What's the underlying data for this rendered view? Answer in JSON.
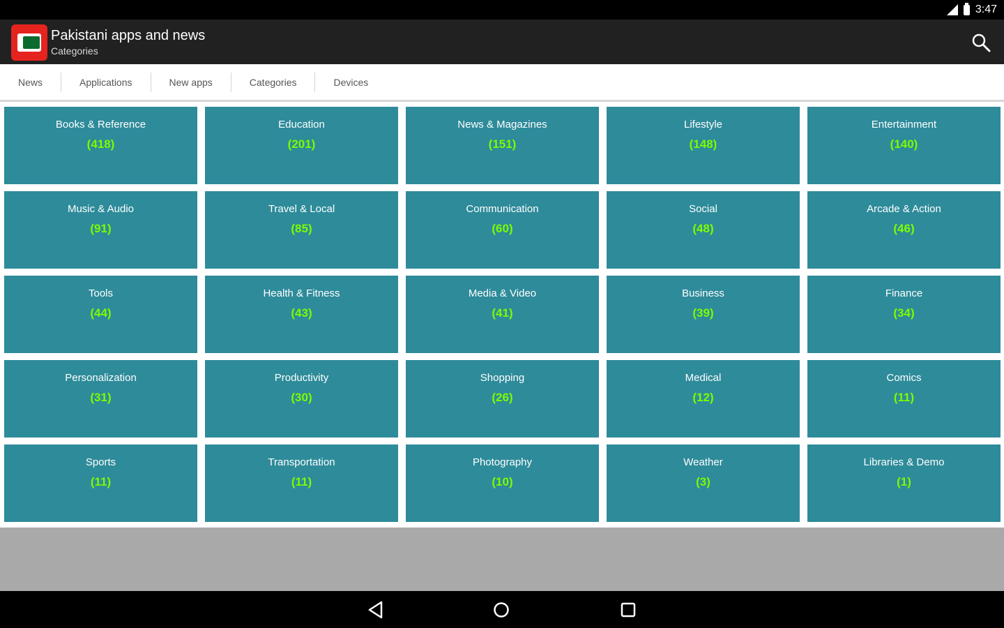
{
  "status_bar": {
    "time": "3:47"
  },
  "app_bar": {
    "title": "Pakistani apps and news",
    "subtitle": "Categories"
  },
  "tabs": [
    {
      "label": "News"
    },
    {
      "label": "Applications"
    },
    {
      "label": "New apps"
    },
    {
      "label": "Categories"
    },
    {
      "label": "Devices"
    }
  ],
  "categories": [
    {
      "name": "Books & Reference",
      "count": "(418)"
    },
    {
      "name": "Education",
      "count": "(201)"
    },
    {
      "name": "News & Magazines",
      "count": "(151)"
    },
    {
      "name": "Lifestyle",
      "count": "(148)"
    },
    {
      "name": "Entertainment",
      "count": "(140)"
    },
    {
      "name": "Music & Audio",
      "count": "(91)"
    },
    {
      "name": "Travel & Local",
      "count": "(85)"
    },
    {
      "name": "Communication",
      "count": "(60)"
    },
    {
      "name": "Social",
      "count": "(48)"
    },
    {
      "name": "Arcade & Action",
      "count": "(46)"
    },
    {
      "name": "Tools",
      "count": "(44)"
    },
    {
      "name": "Health & Fitness",
      "count": "(43)"
    },
    {
      "name": "Media & Video",
      "count": "(41)"
    },
    {
      "name": "Business",
      "count": "(39)"
    },
    {
      "name": "Finance",
      "count": "(34)"
    },
    {
      "name": "Personalization",
      "count": "(31)"
    },
    {
      "name": "Productivity",
      "count": "(30)"
    },
    {
      "name": "Shopping",
      "count": "(26)"
    },
    {
      "name": "Medical",
      "count": "(12)"
    },
    {
      "name": "Comics",
      "count": "(11)"
    },
    {
      "name": "Sports",
      "count": "(11)"
    },
    {
      "name": "Transportation",
      "count": "(11)"
    },
    {
      "name": "Photography",
      "count": "(10)"
    },
    {
      "name": "Weather",
      "count": "(3)"
    },
    {
      "name": "Libraries & Demo",
      "count": "(1)"
    }
  ],
  "colors": {
    "tile_background": "#2e8b9a",
    "count_text": "#7cfc00",
    "app_bar": "#212121",
    "app_icon": "#e52420"
  }
}
